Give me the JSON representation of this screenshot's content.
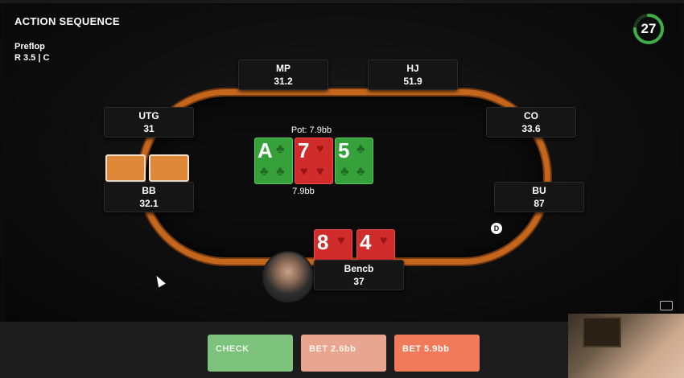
{
  "header": {
    "title": "ACTION SEQUENCE",
    "street": "Preflop",
    "actions": "R 3.5  |  C"
  },
  "timer": {
    "value": "27",
    "fraction_remaining": 0.75
  },
  "seats": {
    "mp": {
      "pos": "MP",
      "stack": "31.2"
    },
    "hj": {
      "pos": "HJ",
      "stack": "51.9"
    },
    "utg": {
      "pos": "UTG",
      "stack": "31"
    },
    "co": {
      "pos": "CO",
      "stack": "33.6"
    },
    "bb": {
      "pos": "BB",
      "stack": "32.1"
    },
    "bu": {
      "pos": "BU",
      "stack": "87"
    },
    "hero": {
      "pos": "Bencb",
      "stack": "37"
    }
  },
  "pot": {
    "label": "Pot: 7.9bb",
    "amount": "7.9bb"
  },
  "board": [
    {
      "rank": "A",
      "suit": "clubs",
      "color": "#36a13b"
    },
    {
      "rank": "7",
      "suit": "hearts",
      "color": "#d02c2c"
    },
    {
      "rank": "5",
      "suit": "clubs",
      "color": "#36a13b"
    }
  ],
  "hero_cards": [
    {
      "rank": "8",
      "suit": "hearts",
      "color": "#d02c2c"
    },
    {
      "rank": "4",
      "suit": "hearts",
      "color": "#d02c2c"
    }
  ],
  "dealer": {
    "label": "D"
  },
  "buttons": {
    "check": "CHECK",
    "bet1": "BET 2.6bb",
    "bet2": "BET 5.9bb"
  },
  "colors": {
    "felt_rail": "#c4661c",
    "check": "#7cc17c",
    "bet_small": "#e8a690",
    "bet_large": "#f07a59",
    "timer_ring": "#3fae49"
  }
}
